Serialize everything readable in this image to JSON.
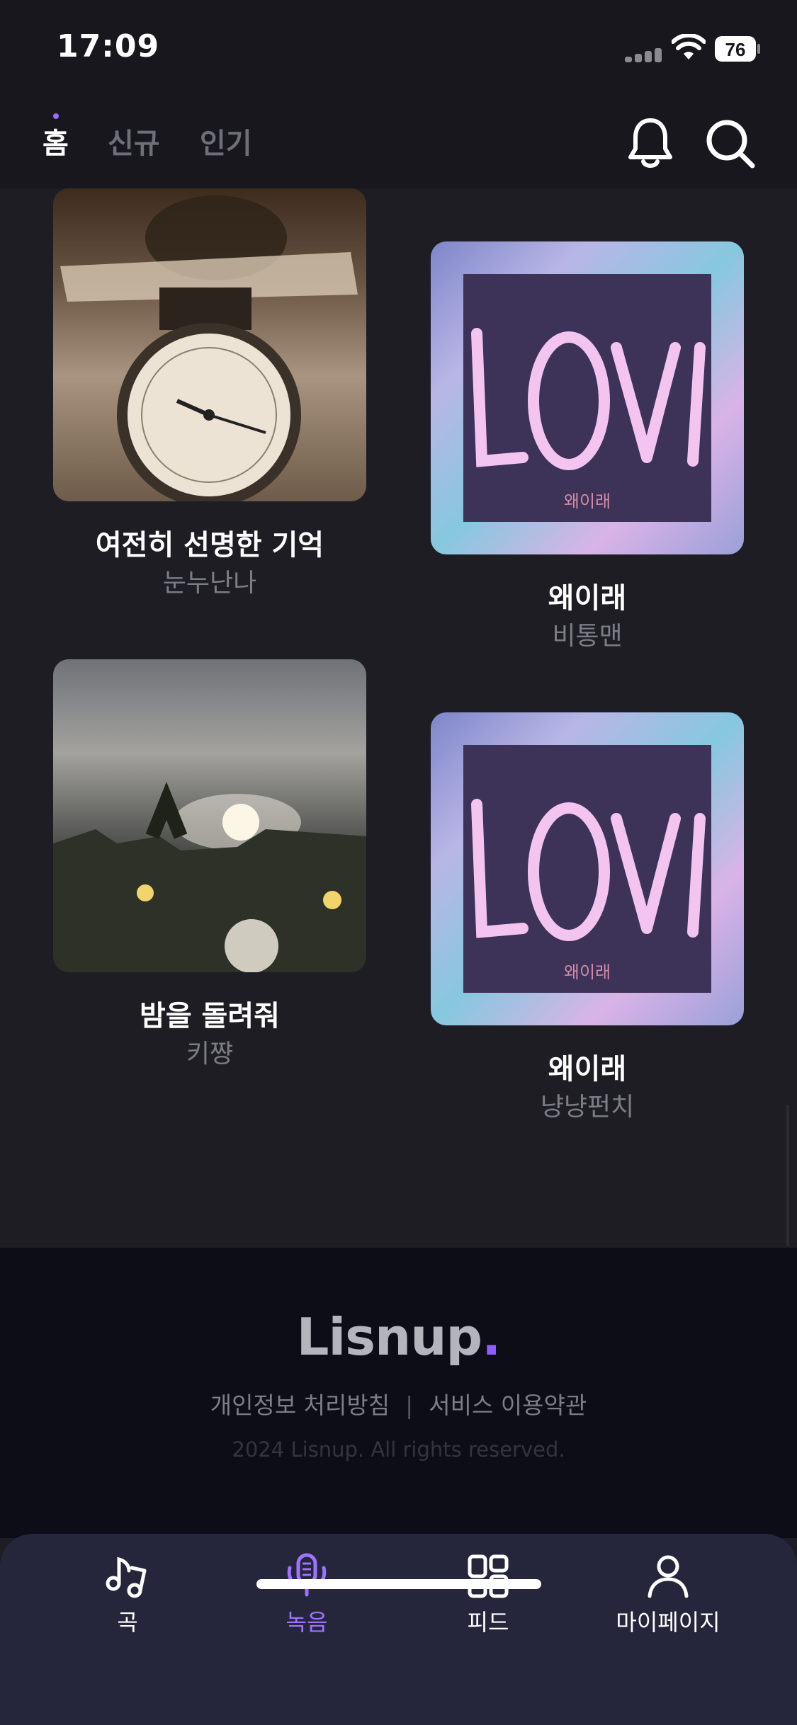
{
  "status_bar": {
    "time": "17:09",
    "battery": "76"
  },
  "header": {
    "tabs": [
      {
        "label": "홈",
        "active": true
      },
      {
        "label": "신규",
        "active": false
      },
      {
        "label": "인기",
        "active": false
      }
    ],
    "icons": [
      "bell-icon",
      "search-icon"
    ]
  },
  "songs": [
    {
      "title": "여전히 선명한 기억",
      "artist": "눈누난나",
      "cover": "scale-photo"
    },
    {
      "title": "왜이래",
      "artist": "비통맨",
      "cover": "love-neon",
      "cover_text": "왜이래"
    },
    {
      "title": "밤을 돌려줘",
      "artist": "키쨩",
      "cover": "sky-photo"
    },
    {
      "title": "왜이래",
      "artist": "냥냥펀치",
      "cover": "love-neon",
      "cover_text": "왜이래"
    }
  ],
  "footer": {
    "logo": "Lisnup",
    "logo_dot": ".",
    "privacy_link": "개인정보 처리방침",
    "separator": "|",
    "terms_link": "서비스 이용약관",
    "copyright": "2024 Lisnup. All rights reserved."
  },
  "bottom_nav": {
    "items": [
      {
        "label": "곡",
        "icon": "music-note-icon",
        "active": false
      },
      {
        "label": "녹음",
        "icon": "microphone-icon",
        "active": true
      },
      {
        "label": "피드",
        "icon": "grid-icon",
        "active": false
      },
      {
        "label": "마이페이지",
        "icon": "person-icon",
        "active": false
      }
    ]
  },
  "colors": {
    "background": "#1d1d23",
    "accent": "#9b6bff",
    "footer": "#0d0d17",
    "nav": "#25263c"
  }
}
